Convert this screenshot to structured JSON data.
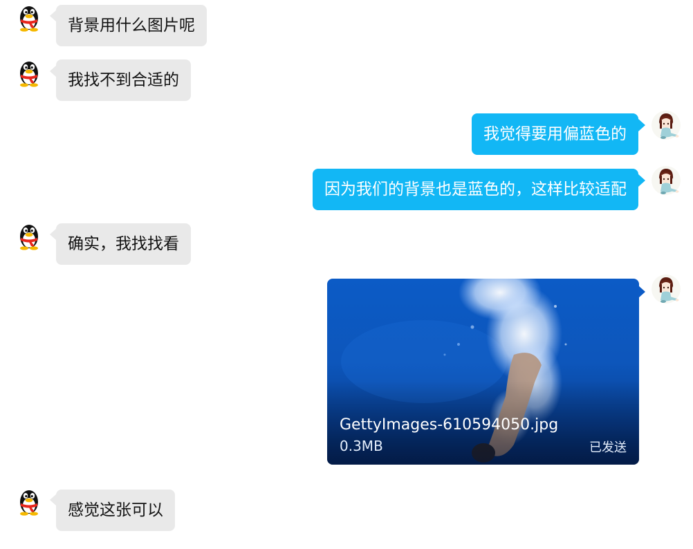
{
  "chat": {
    "messages": [
      {
        "side": "left",
        "text": "背景用什么图片呢"
      },
      {
        "side": "left",
        "text": "我找不到合适的"
      },
      {
        "side": "right",
        "text": "我觉得要用偏蓝色的"
      },
      {
        "side": "right",
        "text": "因为我们的背景也是蓝色的，这样比较适配"
      },
      {
        "side": "left",
        "text": "确实，我找找看"
      },
      {
        "side": "right",
        "type": "file",
        "file_name": "GettyImages-610594050.jpg",
        "file_size": "0.3MB",
        "status": "已发送"
      },
      {
        "side": "left",
        "text": "感觉这张可以"
      }
    ]
  },
  "avatars": {
    "contact": "penguin-avatar",
    "self": "anime-girl-avatar"
  },
  "colors": {
    "left_bubble": "#e9e9e9",
    "right_bubble": "#12b7f5",
    "file_card": "#0b4aa8"
  }
}
